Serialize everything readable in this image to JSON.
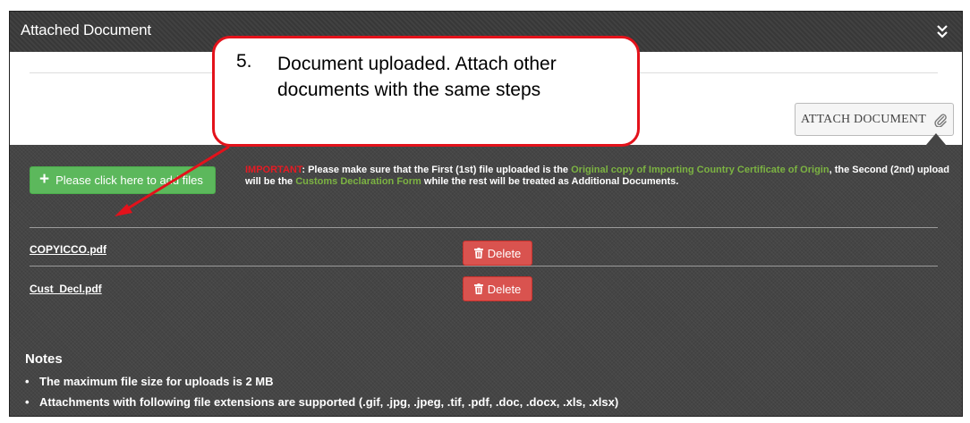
{
  "panel": {
    "title": "Attached Document",
    "collapse_icon": "double-chevron-down-icon"
  },
  "toolbar": {
    "attach_label": "ATTACH DOCUMENT",
    "attach_icon": "paperclip-icon"
  },
  "upload": {
    "add_files_label": "Please click here to add files",
    "add_files_icon": "plus-icon",
    "important": {
      "label": "IMPORTANT",
      "text_1": ": Please make sure that the First (1st) file uploaded is the ",
      "highlight_1": "Original copy of Importing Country Certificate of Origin",
      "text_2": ", the Second (2nd) upload will be the ",
      "highlight_2": "Customs Declaration Form",
      "text_3": " while the rest will be treated as Additional Documents."
    }
  },
  "files": [
    {
      "name": "COPYICCO.pdf",
      "delete_label": "Delete"
    },
    {
      "name": "Cust_Decl.pdf",
      "delete_label": "Delete"
    }
  ],
  "notes": {
    "title": "Notes",
    "items": [
      "The maximum file size for uploads is 2 MB",
      "Attachments with following file extensions are supported (.gif, .jpg, .jpeg, .tif, .pdf, .doc, .docx, .xls, .xlsx)"
    ]
  },
  "callout": {
    "number": "5.",
    "text": "Document uploaded. Attach other documents with the same steps"
  },
  "colors": {
    "accent_red": "#e3121b",
    "success_green": "#5cb85c",
    "danger_red": "#d9534f",
    "highlight_green": "#7cb342",
    "panel_dark": "#454545"
  }
}
